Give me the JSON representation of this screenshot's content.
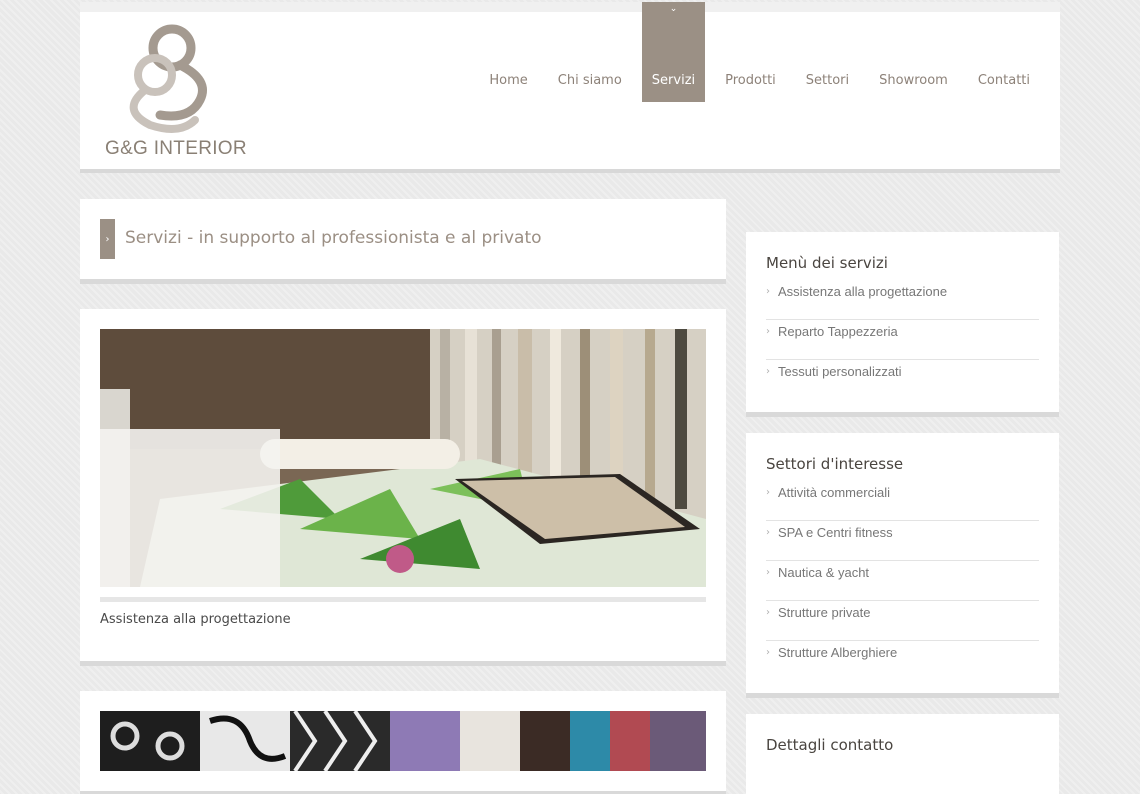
{
  "brand": {
    "name": "G&G INTERIOR",
    "logo_color": "#a49a90"
  },
  "nav": {
    "items": [
      {
        "label": "Home"
      },
      {
        "label": "Chi siamo"
      },
      {
        "label": "Servizi",
        "active": true
      },
      {
        "label": "Prodotti"
      },
      {
        "label": "Settori"
      },
      {
        "label": "Showroom"
      },
      {
        "label": "Contatti"
      }
    ],
    "accent": "#9b9085"
  },
  "page": {
    "title": "Servizi - in supporto al professionista e al privato"
  },
  "services": [
    {
      "caption": "Assistenza alla progettazione"
    },
    {
      "caption": ""
    }
  ],
  "sidebar": {
    "menu": {
      "title": "Menù dei servizi",
      "items": [
        {
          "label": "Assistenza alla progettazione"
        },
        {
          "label": "Reparto Tappezzeria"
        },
        {
          "label": "Tessuti personalizzati"
        }
      ]
    },
    "sectors": {
      "title": "Settori d'interesse",
      "items": [
        {
          "label": "Attività commerciali"
        },
        {
          "label": "SPA e Centri fitness"
        },
        {
          "label": "Nautica & yacht"
        },
        {
          "label": "Strutture private"
        },
        {
          "label": "Strutture Alberghiere"
        }
      ]
    },
    "contact": {
      "title": "Dettagli contatto"
    }
  }
}
